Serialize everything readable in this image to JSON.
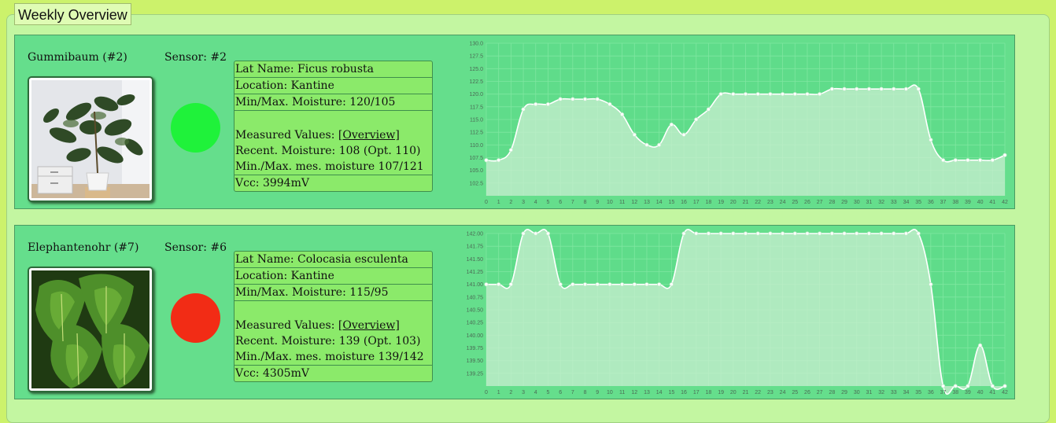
{
  "page": {
    "legend": "Weekly Overview"
  },
  "plants": [
    {
      "name": "Gummibaum (#2)",
      "sensor": "Sensor: #2",
      "status_color": "#1ff23a",
      "info": {
        "lat_name": "Lat Name: Ficus robusta",
        "location": "Location: Kantine",
        "min_max": "Min/Max. Moisture: 120/105",
        "measured_prefix": "Measured Values: ",
        "overview_link": "[Overview]",
        "recent": "Recent. Moisture: 108 (Opt. 110)",
        "min_max_measured": "Min./Max. mes. moisture 107/121",
        "vcc": "Vcc: 3994mV"
      },
      "photo": "rubber-plant"
    },
    {
      "name": "Elephantenohr (#7)",
      "sensor": "Sensor: #6",
      "status_color": "#f22c15",
      "info": {
        "lat_name": "Lat Name: Colocasia esculenta",
        "location": "Location: Kantine",
        "min_max": "Min/Max. Moisture: 115/95",
        "measured_prefix": "Measured Values: ",
        "overview_link": "[Overview]",
        "recent": "Recent. Moisture: 139 (Opt. 103)",
        "min_max_measured": "Min./Max. mes. moisture 139/142",
        "vcc": "Vcc: 4305mV"
      },
      "photo": "elephant-ear"
    }
  ],
  "chart_data": [
    {
      "type": "area",
      "title": "",
      "x": [
        0,
        1,
        2,
        3,
        4,
        5,
        6,
        7,
        8,
        9,
        10,
        11,
        12,
        13,
        14,
        15,
        16,
        17,
        18,
        19,
        20,
        21,
        22,
        23,
        24,
        25,
        26,
        27,
        28,
        29,
        30,
        31,
        32,
        33,
        34,
        35,
        36,
        37,
        38,
        39,
        40,
        41,
        42
      ],
      "values": [
        107,
        107,
        109,
        117,
        118,
        118,
        119,
        119,
        119,
        119,
        118,
        116,
        112,
        110,
        110,
        114,
        112,
        115,
        117,
        120,
        120,
        120,
        120,
        120,
        120,
        120,
        120,
        120,
        121,
        121,
        121,
        121,
        121,
        121,
        121,
        121,
        111,
        107,
        107,
        107,
        107,
        107,
        108
      ],
      "ylim": [
        100,
        130
      ],
      "yticks": [
        "102.5",
        "105.0",
        "107.5",
        "110.0",
        "112.5",
        "115.0",
        "117.5",
        "120.0",
        "122.5",
        "125.0",
        "127.5",
        "130.0"
      ],
      "ytick_values": [
        102.5,
        105,
        107.5,
        110,
        112.5,
        115,
        117.5,
        120,
        122.5,
        125,
        127.5,
        130
      ],
      "grid": true,
      "line_color": "#ffffff",
      "fill_color": "#c9efd0"
    },
    {
      "type": "area",
      "title": "",
      "x": [
        0,
        1,
        2,
        3,
        4,
        5,
        6,
        7,
        8,
        9,
        10,
        11,
        12,
        13,
        14,
        15,
        16,
        17,
        18,
        19,
        20,
        21,
        22,
        23,
        24,
        25,
        26,
        27,
        28,
        29,
        30,
        31,
        32,
        33,
        34,
        35,
        36,
        37,
        38,
        39,
        40,
        41,
        42
      ],
      "values": [
        141,
        141,
        141,
        142,
        142,
        142,
        141,
        141,
        141,
        141,
        141,
        141,
        141,
        141,
        141,
        141,
        142,
        142,
        142,
        142,
        142,
        142,
        142,
        142,
        142,
        142,
        142,
        142,
        142,
        142,
        142,
        142,
        142,
        142,
        142,
        142,
        141,
        139,
        139,
        139,
        139.8,
        139,
        139
      ],
      "ylim": [
        139,
        142
      ],
      "yticks": [
        "139.25",
        "139.50",
        "139.75",
        "140.00",
        "140.25",
        "140.50",
        "140.75",
        "141.00",
        "141.25",
        "141.50",
        "141.75",
        "142.00"
      ],
      "ytick_values": [
        139.25,
        139.5,
        139.75,
        140,
        140.25,
        140.5,
        140.75,
        141,
        141.25,
        141.5,
        141.75,
        142
      ],
      "grid": true,
      "line_color": "#ffffff",
      "fill_color": "#c9efd0"
    }
  ]
}
